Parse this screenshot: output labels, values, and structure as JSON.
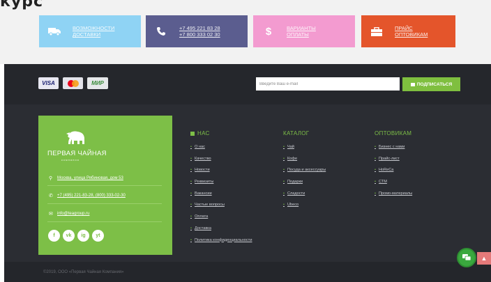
{
  "top": {
    "title_fragment": "курс",
    "promos": [
      {
        "icon": "truck-icon",
        "lines": [
          "ВОЗМОЖНОСТИ",
          "ДОСТАВКИ"
        ]
      },
      {
        "icon": "phone-icon",
        "lines": [
          "+7 495 221 83 28",
          "+7 800 333 02 30"
        ]
      },
      {
        "icon": "dollar-icon",
        "lines": [
          "ВАРИАНТЫ",
          "ОПЛАТЫ"
        ]
      },
      {
        "icon": "briefcase-icon",
        "lines": [
          "ПРАЙС",
          "ОПТОВИКАМ"
        ]
      }
    ]
  },
  "band": {
    "cards": [
      "VISA",
      "MasterCard",
      "МИР"
    ],
    "email_placeholder": "Введите Ваш e-mail",
    "subscribe_label": "подписаться"
  },
  "company": {
    "name": "ПЕРВАЯ ЧАЙНАЯ",
    "sub": "компания",
    "address": "Москва, улица Рябиновая, дом 53",
    "phones": "+7 (495) 221-83-28, (800) 333-02-30",
    "email": "info@teagroup.ru",
    "socials": [
      "f",
      "vk",
      "ig",
      "yt"
    ]
  },
  "columns": [
    {
      "title": "НАС",
      "items": [
        "О нас",
        "Качество",
        "Новости",
        "Реквизиты",
        "Вакансии",
        "Частые вопросы",
        "Оплата",
        "Доставка",
        "Политика конфиденциальности"
      ]
    },
    {
      "title": "КАТАЛОГ",
      "items": [
        "Чай",
        "Кофе",
        "Посуда и аксессуары",
        "Подарки",
        "Сладости",
        "Ubeco"
      ]
    },
    {
      "title": "ОПТОВИКАМ",
      "items": [
        "Бизнес с нами",
        "Прайс-лист",
        "HoReCa",
        "СТМ",
        "Промо-материалы"
      ]
    }
  ],
  "footer": {
    "copyright": "©2019, ООО «Первая Чайная Компания»"
  },
  "colors": {
    "accent": "#7dbf47",
    "dark": "#2b2d33"
  }
}
